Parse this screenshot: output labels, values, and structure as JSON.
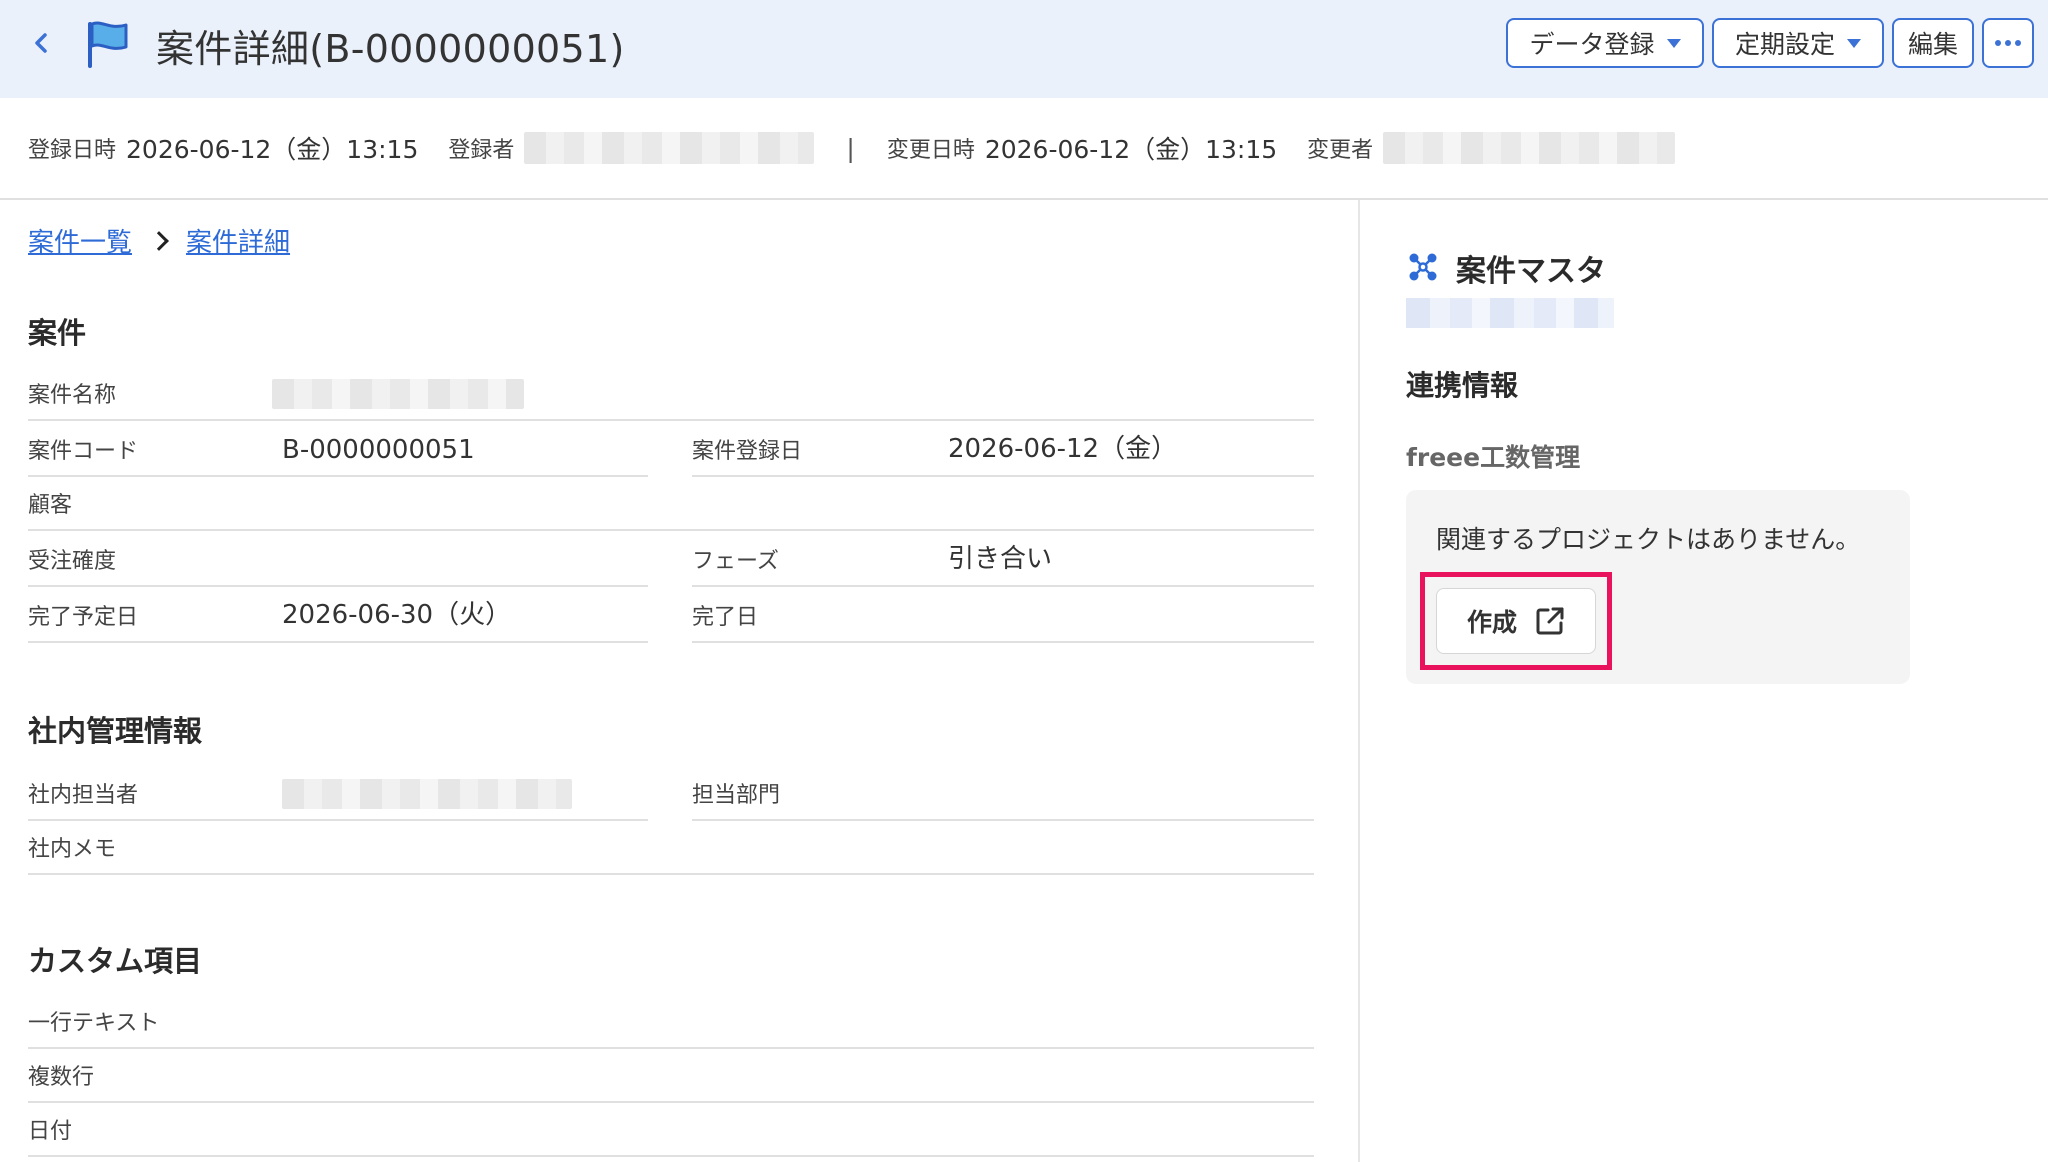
{
  "header": {
    "title": "案件詳細(B-0000000051)",
    "buttons": {
      "data_register": "データ登録",
      "periodic": "定期設定",
      "edit": "編集"
    }
  },
  "meta": {
    "created_label": "登録日時",
    "created_value": "2026-06-12（金）13:15",
    "creator_label": "登録者",
    "separator": "|",
    "updated_label": "変更日時",
    "updated_value": "2026-06-12（金）13:15",
    "updater_label": "変更者"
  },
  "breadcrumb": {
    "list": "案件一覧",
    "detail": "案件詳細"
  },
  "sections": {
    "project": {
      "title": "案件",
      "name_label": "案件名称",
      "code_label": "案件コード",
      "code_value": "B-0000000051",
      "reg_date_label": "案件登録日",
      "reg_date_value": "2026-06-12（金）",
      "customer_label": "顧客",
      "probability_label": "受注確度",
      "phase_label": "フェーズ",
      "phase_value": "引き合い",
      "due_label": "完了予定日",
      "due_value": "2026-06-30（火）",
      "done_label": "完了日"
    },
    "internal": {
      "title": "社内管理情報",
      "owner_label": "社内担当者",
      "dept_label": "担当部門",
      "memo_label": "社内メモ"
    },
    "custom": {
      "title": "カスタム項目",
      "single_label": "一行テキスト",
      "multi_label": "複数行",
      "date_label": "日付"
    }
  },
  "right_panel": {
    "title": "案件マスタ",
    "integration_title": "連携情報",
    "service_name": "freee工数管理",
    "no_project_msg": "関連するプロジェクトはありません。",
    "create_label": "作成"
  },
  "colors": {
    "accent": "#3c71d6",
    "header_bg": "#eaf1fb",
    "highlight": "#e8135c"
  }
}
